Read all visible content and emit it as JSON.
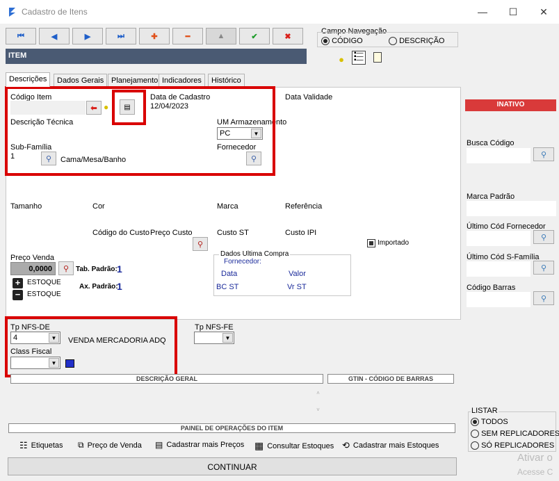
{
  "window": {
    "title": "Cadastro de Itens",
    "minimize": "—",
    "maximize": "☐",
    "close": "✕"
  },
  "nav": {
    "first": "⏮",
    "prev": "◀",
    "next": "▶",
    "last": "⏭",
    "add": "✚",
    "remove": "━",
    "up": "▲",
    "confirm": "✔",
    "cancel": "✖"
  },
  "campo_nav": {
    "legend": "Campo Navegação",
    "opt_codigo": "CÓDIGO",
    "opt_descricao": "DESCRIÇÃO"
  },
  "section_title": "ITEM",
  "tabs": [
    "Descrições",
    "Dados Gerais",
    "Planejamento",
    "Indicadores",
    "Histórico"
  ],
  "fields": {
    "codigo_item": "Código Item",
    "data_cadastro_label": "Data de Cadastro",
    "data_cadastro_value": "12/04/2023",
    "data_validade": "Data Validade",
    "descricao_tecnica": "Descrição Técnica",
    "um_armazenamento": "UM Armazenamento",
    "um_value": "PC",
    "sub_familia": "Sub-Família",
    "sub_familia_code": "1",
    "sub_familia_desc": "Cama/Mesa/Banho",
    "fornecedor": "Fornecedor",
    "tamanho": "Tamanho",
    "cor": "Cor",
    "marca": "Marca",
    "referencia": "Referência",
    "codigo_custo": "Código do Custo",
    "preco_custo": "Preço Custo",
    "custo_st": "Custo ST",
    "custo_ipi": "Custo IPI",
    "importado": "Importado",
    "preco_venda": "Preço Venda",
    "preco_venda_value": "0,0000",
    "tab_padrao": "Tab. Padrão:",
    "tab_padrao_value": "1",
    "ax_padrao": "Ax. Padrão:",
    "ax_padrao_value": "1",
    "estoque_add": "ESTOQUE",
    "estoque_sub": "ESTOQUE",
    "ultima_compra_title": "Dados Ultima Compra",
    "ultima_compra_fornecedor": "Fornecedor:",
    "uc_data": "Data",
    "uc_valor": "Valor",
    "uc_bcst": "BC ST",
    "uc_vrst": "Vr ST",
    "tp_nfs_de": "Tp NFS-DE",
    "tp_nfs_de_value": "4",
    "tp_nfs_de_desc": "VENDA MERCADORIA ADQ",
    "tp_nfs_fe": "Tp NFS-FE",
    "class_fiscal": "Class Fiscal",
    "descricao_geral": "DESCRIÇÃO GERAL",
    "gtin": "GTIN - CÓDIGO DE BARRAS",
    "painel_operacoes": "PAINEL DE OPERAÇÕES DO ITEM"
  },
  "actions": [
    "Etiquetas",
    "Preço de Venda",
    "Cadastrar mais Preços",
    "Consultar Estoques",
    "Cadastrar mais Estoques"
  ],
  "continuar": "CONTINUAR",
  "right": {
    "status": "INATIVO",
    "busca_codigo": "Busca Código",
    "marca_padrao": "Marca Padrão",
    "ultimo_fornecedor": "Último Cód Fornecedor",
    "ultimo_sfamilia": "Último Cód S-Família",
    "codigo_barras": "Código Barras",
    "listar": "LISTAR",
    "opt_todos": "TODOS",
    "opt_sem": "SEM REPLICADORES",
    "opt_so": "SÓ REPLICADORES"
  },
  "watermark": {
    "line1": "Ativar o",
    "line2": "Acesse C"
  },
  "colors": {
    "accent_red": "#d90000",
    "status_red": "#d93a3a",
    "header_blue": "#4a5a73",
    "number_blue": "#1a2a9a"
  }
}
